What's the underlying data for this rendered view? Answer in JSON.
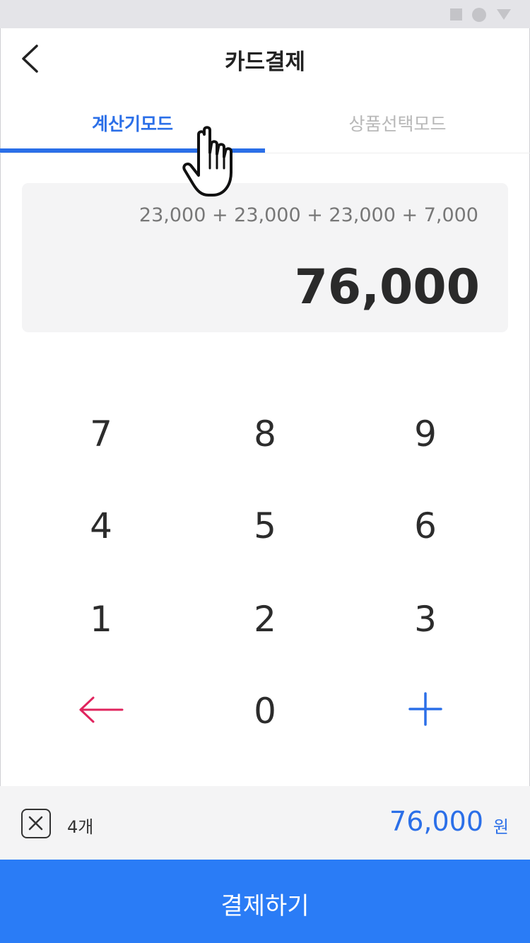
{
  "header": {
    "title": "카드결제"
  },
  "tabs": [
    {
      "label": "계산기모드",
      "active": true
    },
    {
      "label": "상품선택모드",
      "active": false
    }
  ],
  "display": {
    "expression": "23,000 + 23,000 + 23,000 + 7,000",
    "result": "76,000"
  },
  "keypad": {
    "digits": [
      "7",
      "8",
      "9",
      "4",
      "5",
      "6",
      "1",
      "2",
      "3",
      "0"
    ],
    "backspace_icon": "arrow-left-icon",
    "plus_icon": "plus-icon"
  },
  "summary": {
    "count": "4개",
    "total": "76,000",
    "currency": "원"
  },
  "pay_button": {
    "label": "결제하기"
  },
  "colors": {
    "accent": "#2b6fe8",
    "pay_button": "#2a7cf6",
    "backspace": "#e0245e"
  }
}
